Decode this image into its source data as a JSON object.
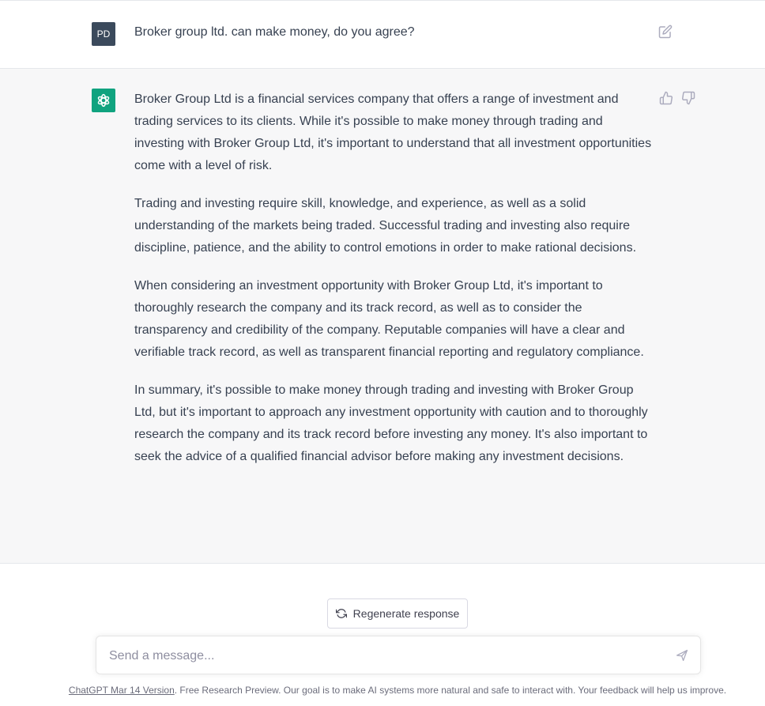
{
  "conversation": {
    "user": {
      "avatar_initials": "PD",
      "message": "Broker group ltd. can make money, do you agree?"
    },
    "assistant": {
      "paragraphs": [
        "Broker Group Ltd is a financial services company that offers a range of investment and trading services to its clients. While it's possible to make money through trading and investing with Broker Group Ltd, it's important to understand that all investment opportunities come with a level of risk.",
        "Trading and investing require skill, knowledge, and experience, as well as a solid understanding of the markets being traded. Successful trading and investing also require discipline, patience, and the ability to control emotions in order to make rational decisions.",
        "When considering an investment opportunity with Broker Group Ltd, it's important to thoroughly research the company and its track record, as well as to consider the transparency and credibility of the company. Reputable companies will have a clear and verifiable track record, as well as transparent financial reporting and regulatory compliance.",
        "In summary, it's possible to make money through trading and investing with Broker Group Ltd, but it's important to approach any investment opportunity with caution and to thoroughly research the company and its track record before investing any money. It's also important to seek the advice of a qualified financial advisor before making any investment decisions."
      ]
    }
  },
  "icons": {
    "edit": "edit-icon",
    "thumbs_up": "thumbs-up-icon",
    "thumbs_down": "thumbs-down-icon",
    "regenerate": "refresh-icon",
    "send": "send-icon",
    "assistant_logo": "openai-logo-icon"
  },
  "composer": {
    "regenerate_label": "Regenerate response",
    "placeholder": "Send a message..."
  },
  "footer": {
    "version_link": "ChatGPT Mar 14 Version",
    "text": ". Free Research Preview. Our goal is to make AI systems more natural and safe to interact with. Your feedback will help us improve."
  },
  "colors": {
    "assistant_bg": "#f7f7f8",
    "brand_green": "#10a37f",
    "user_avatar": "#3b4a5c"
  }
}
